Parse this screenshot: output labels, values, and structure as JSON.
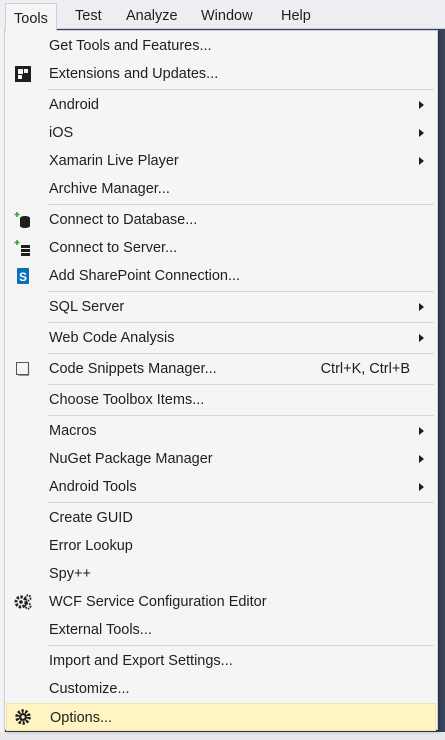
{
  "menubar": {
    "items": [
      "Tools",
      "Test",
      "Analyze",
      "Window",
      "Help"
    ]
  },
  "menu": {
    "items": [
      {
        "label": "Get Tools and Features..."
      },
      {
        "label": "Extensions and Updates...",
        "icon": "extensions-icon"
      },
      {
        "label": "Android",
        "submenu": true
      },
      {
        "label": "iOS",
        "submenu": true
      },
      {
        "label": "Xamarin Live Player",
        "submenu": true
      },
      {
        "label": "Archive Manager..."
      },
      {
        "label": "Connect to Database...",
        "icon": "database-connect-icon"
      },
      {
        "label": "Connect to Server...",
        "icon": "server-connect-icon"
      },
      {
        "label": "Add SharePoint Connection...",
        "icon": "sharepoint-icon"
      },
      {
        "label": "SQL Server",
        "submenu": true
      },
      {
        "label": "Web Code Analysis",
        "submenu": true
      },
      {
        "label": "Code Snippets Manager...",
        "shortcut": "Ctrl+K, Ctrl+B",
        "icon": "snippet-checkbox-icon"
      },
      {
        "label": "Choose Toolbox Items..."
      },
      {
        "label": "Macros",
        "submenu": true
      },
      {
        "label": "NuGet Package Manager",
        "submenu": true
      },
      {
        "label": "Android Tools",
        "submenu": true
      },
      {
        "label": "Create GUID"
      },
      {
        "label": "Error Lookup"
      },
      {
        "label": "Spy++"
      },
      {
        "label": "WCF Service Configuration Editor",
        "icon": "wcf-gears-icon"
      },
      {
        "label": "External Tools..."
      },
      {
        "label": "Import and Export Settings..."
      },
      {
        "label": "Customize..."
      },
      {
        "label": "Options...",
        "icon": "gear-icon",
        "highlighted": true
      }
    ]
  },
  "colors": {
    "menu_bg": "#f5f5f5",
    "highlight_bg": "#fff4c2",
    "background": "#3a4458",
    "sharepoint_blue": "#0a6fb9",
    "connect_green": "#3c9b3c"
  }
}
